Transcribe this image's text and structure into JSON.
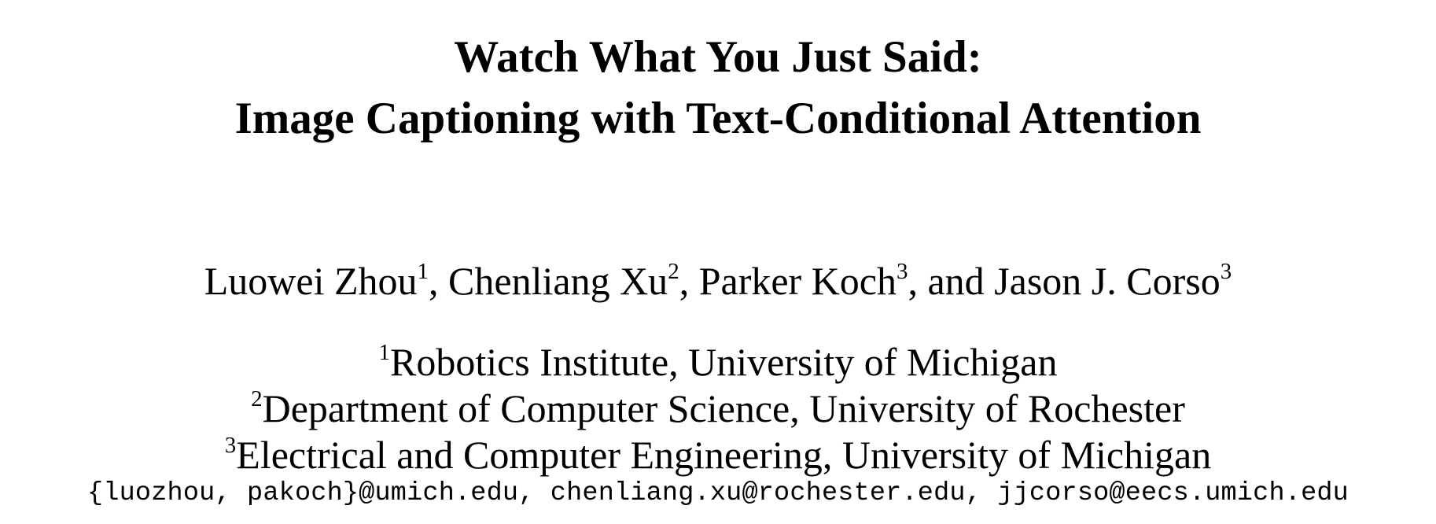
{
  "title": {
    "line1": "Watch What You Just Said:",
    "line2": "Image Captioning with Text-Conditional Attention"
  },
  "authors": [
    {
      "name": "Luowei Zhou",
      "mark": "1",
      "sep": ", "
    },
    {
      "name": "Chenliang Xu",
      "mark": "2",
      "sep": ", "
    },
    {
      "name": "Parker Koch",
      "mark": "3",
      "sep": ", and "
    },
    {
      "name": "Jason J. Corso",
      "mark": "3",
      "sep": ""
    }
  ],
  "affiliations": [
    {
      "mark": "1",
      "text": "Robotics Institute, University of Michigan"
    },
    {
      "mark": "2",
      "text": "Department of Computer Science, University of Rochester"
    },
    {
      "mark": "3",
      "text": "Electrical and Computer Engineering, University of Michigan"
    }
  ],
  "emails": "{luozhou, pakoch}@umich.edu, chenliang.xu@rochester.edu, jjcorso@eecs.umich.edu"
}
